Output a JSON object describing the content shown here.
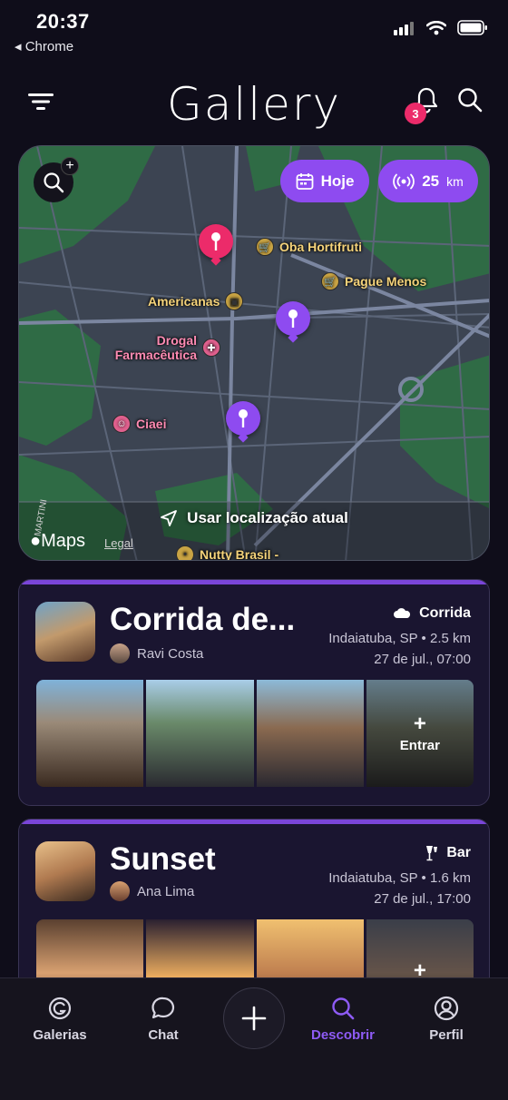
{
  "status_bar": {
    "time": "20:37",
    "back_label": "◂ Chrome"
  },
  "header": {
    "title": "Gallery",
    "notification_count": "3"
  },
  "map": {
    "date_chip": "Hoje",
    "radius_value": "25",
    "radius_unit": "km",
    "pois": [
      "Oba Hortifruti",
      "Pague Menos",
      "Americanas",
      "Drogal Farmacêutica",
      "Ciaei",
      "Nutty Brasil -"
    ],
    "use_location_label": "Usar localização atual",
    "maps_label": "Maps",
    "legal_label": "Legal",
    "street_label": "MARTINI"
  },
  "events": [
    {
      "title": "Corrida de...",
      "host": "Ravi Costa",
      "category": "Corrida",
      "location": "Indaiatuba, SP",
      "distance": "2.5 km",
      "datetime": "27 de jul., 07:00",
      "enter_label": "Entrar"
    },
    {
      "title": "Sunset",
      "host": "Ana Lima",
      "category": "Bar",
      "location": "Indaiatuba, SP",
      "distance": "1.6 km",
      "datetime": "27 de jul., 17:00",
      "enter_label": ""
    }
  ],
  "tabs": [
    {
      "label": "Galerias"
    },
    {
      "label": "Chat"
    },
    {
      "label": "Descobrir"
    },
    {
      "label": "Perfil"
    }
  ],
  "colors": {
    "accent": "#8e4bf0",
    "badge": "#ec2b6a",
    "background": "#0f0d1a"
  }
}
